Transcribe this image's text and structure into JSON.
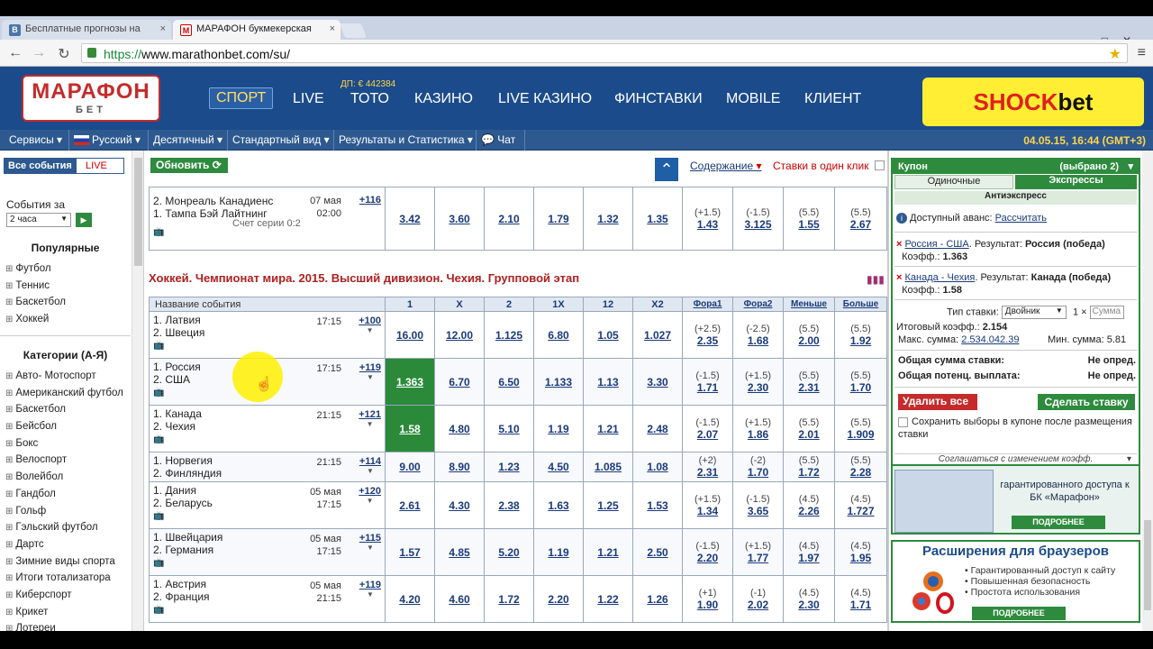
{
  "browser": {
    "tabs": [
      {
        "label": "Бесплатные прогнозы на",
        "favicon": "B"
      },
      {
        "label": "МАРАФОН букмекерская",
        "favicon": "M"
      }
    ],
    "url_prefix": "https://",
    "url": "www.marathonbet.com/su/"
  },
  "header": {
    "logo_top": "МАРАФОН",
    "logo_bottom": "БЕТ",
    "nav": [
      "СПОРТ",
      "LIVE",
      "ТОТО",
      "КАЗИНО",
      "LIVE КАЗИНО",
      "ФИНСТАВКИ",
      "MOBILE",
      "КЛИЕНТ"
    ],
    "toto_jackpot": "ДП: € 442384",
    "ad_red": "SHOCK",
    "ad_black": "bet"
  },
  "menubar": {
    "items": [
      "Сервисы",
      "Русский",
      "Десятичный",
      "Стандартный вид",
      "Результаты и Статистика",
      "Чат"
    ],
    "datetime": "04.05.15, 16:44 (GMT+3)"
  },
  "sidebar": {
    "tab_all": "Все события",
    "tab_live": "LIVE",
    "events_for": "События за",
    "period": "2 часа",
    "popular_title": "Популярные",
    "popular": [
      "Футбол",
      "Теннис",
      "Баскетбол",
      "Хоккей"
    ],
    "categories_title": "Категории (А-Я)",
    "categories": [
      "Авто- Мотоспорт",
      "Американский футбол",
      "Баскетбол",
      "Бейсбол",
      "Бокс",
      "Велоспорт",
      "Волейбол",
      "Гандбол",
      "Гольф",
      "Гэльский футбол",
      "Дартс",
      "Зимние виды спорта",
      "Итоги тотализатора",
      "Киберспорт",
      "Крикет",
      "Лотереи"
    ]
  },
  "center": {
    "refresh": "Обновить",
    "toc": "Содержание",
    "one_click": "Ставки в один клик",
    "prev_match": {
      "team1": "2. Монреаль Канадиенс",
      "team2": "1. Тампа Бэй Лайтнинг",
      "date": "07 мая",
      "time": "02:00",
      "series": "Счет серии 0:2",
      "plus": "+116",
      "odds": [
        "3.42",
        "3.60",
        "2.10",
        "1.79",
        "1.32",
        "1.35"
      ],
      "h1": "(+1.5)",
      "h1v": "1.43",
      "h2": "(-1.5)",
      "h2v": "3.125",
      "u": "(5.5)",
      "uv": "1.55",
      "o": "(5.5)",
      "ov": "2.67"
    },
    "section_title": "Хоккей. Чемпионат мира. 2015. Высший дивизион. Чехия. Групповой этап",
    "columns": [
      "Название события",
      "1",
      "X",
      "2",
      "1X",
      "12",
      "X2",
      "Фора1",
      "Фора2",
      "Меньше",
      "Больше"
    ],
    "matches": [
      {
        "t1": "1. Латвия",
        "t2": "2. Швеция",
        "date": "",
        "time": "17:15",
        "plus": "+100",
        "odds": [
          "16.00",
          "12.00",
          "1.125",
          "6.80",
          "1.05",
          "1.027"
        ],
        "h1": "(+2.5)",
        "h1v": "2.35",
        "h2": "(-2.5)",
        "h2v": "1.68",
        "u": "(5.5)",
        "uv": "2.00",
        "o": "(5.5)",
        "ov": "1.92",
        "tv": true
      },
      {
        "t1": "1. Россия",
        "t2": "2. США",
        "date": "",
        "time": "17:15",
        "plus": "+119",
        "odds": [
          "1.363",
          "6.70",
          "6.50",
          "1.133",
          "1.13",
          "3.30"
        ],
        "h1": "(-1.5)",
        "h1v": "1.71",
        "h2": "(+1.5)",
        "h2v": "2.30",
        "u": "(5.5)",
        "uv": "2.31",
        "o": "(5.5)",
        "ov": "1.70",
        "tv": true,
        "sel": 0
      },
      {
        "t1": "1. Канада",
        "t2": "2. Чехия",
        "date": "",
        "time": "21:15",
        "plus": "+121",
        "odds": [
          "1.58",
          "4.80",
          "5.10",
          "1.19",
          "1.21",
          "2.48"
        ],
        "h1": "(-1.5)",
        "h1v": "2.07",
        "h2": "(+1.5)",
        "h2v": "1.86",
        "u": "(5.5)",
        "uv": "2.01",
        "o": "(5.5)",
        "ov": "1.909",
        "tv": true,
        "sel": 0
      },
      {
        "t1": "1. Норвегия",
        "t2": "2. Финляндия",
        "date": "",
        "time": "21:15",
        "plus": "+114",
        "odds": [
          "9.00",
          "8.90",
          "1.23",
          "4.50",
          "1.085",
          "1.08"
        ],
        "h1": "(+2)",
        "h1v": "2.31",
        "h2": "(-2)",
        "h2v": "1.70",
        "u": "(5.5)",
        "uv": "1.72",
        "o": "(5.5)",
        "ov": "2.28",
        "tv": false
      },
      {
        "t1": "1. Дания",
        "t2": "2. Беларусь",
        "date": "05 мая",
        "time": "17:15",
        "plus": "+120",
        "odds": [
          "2.61",
          "4.30",
          "2.38",
          "1.63",
          "1.25",
          "1.53"
        ],
        "h1": "(+1.5)",
        "h1v": "1.34",
        "h2": "(-1.5)",
        "h2v": "3.65",
        "u": "(4.5)",
        "uv": "2.26",
        "o": "(4.5)",
        "ov": "1.727",
        "tv": true
      },
      {
        "t1": "1. Швейцария",
        "t2": "2. Германия",
        "date": "05 мая",
        "time": "17:15",
        "plus": "+115",
        "odds": [
          "1.57",
          "4.85",
          "5.20",
          "1.19",
          "1.21",
          "2.50"
        ],
        "h1": "(-1.5)",
        "h1v": "2.20",
        "h2": "(+1.5)",
        "h2v": "1.77",
        "u": "(4.5)",
        "uv": "1.97",
        "o": "(4.5)",
        "ov": "1.95",
        "tv": true
      },
      {
        "t1": "1. Австрия",
        "t2": "2. Франция",
        "date": "05 мая",
        "time": "21:15",
        "plus": "+119",
        "odds": [
          "4.20",
          "4.60",
          "1.72",
          "2.20",
          "1.22",
          "1.26"
        ],
        "h1": "(+1)",
        "h1v": "1.90",
        "h2": "(-1)",
        "h2v": "2.02",
        "u": "(4.5)",
        "uv": "2.30",
        "o": "(4.5)",
        "ov": "1.71",
        "tv": true
      }
    ]
  },
  "coupon": {
    "title": "Купон",
    "count": "(выбрано 2)",
    "tab_single": "Одиночные",
    "tab_express": "Экспрессы",
    "anti": "Антиэкспресс",
    "avans": "Доступный аванс:",
    "avans_link": "Рассчитать",
    "bets": [
      {
        "event": "Россия - США",
        "res_label": ". Результат:",
        "res": "Россия (победа)",
        "k_label": "Коэфф.:",
        "k": "1.363"
      },
      {
        "event": "Канада - Чехия",
        "res_label": ". Результат:",
        "res": "Канада (победа)",
        "k_label": "Коэфф.:",
        "k": "1.58"
      }
    ],
    "type_label": "Тип ставки:",
    "type_value": "Двойник",
    "mult": "1 ×",
    "sum_placeholder": "Сумма",
    "total_label": "Итоговый коэфф.:",
    "total": "2.154",
    "max_label": "Макс. сумма:",
    "max": "2.534.042.39",
    "min_label": "Мин. сумма:",
    "min": "5.81",
    "sum_label": "Общая сумма ставки:",
    "sum_val": "Не опред.",
    "payout_label": "Общая потенц. выплата:",
    "payout_val": "Не опред.",
    "delete_all": "Удалить все",
    "place_bet": "Сделать ставку",
    "save_sel": "Сохранить выборы в купоне после размещения ставки",
    "agree": "Соглашаться с изменением коэфф."
  },
  "ads": {
    "ad1_text": "гарантированного доступа к БК «Марафон»",
    "ad1_btn": "ПОДРОБНЕЕ",
    "ad2_title": "Расширения для браузеров",
    "ad2_items": [
      "Гарантированный доступ к сайту",
      "Повышенная безопасность",
      "Простота использования"
    ],
    "ad2_btn": "ПОДРОБНЕЕ"
  },
  "colors": {
    "brand_blue": "#1b4b8a",
    "accent_green": "#2e8b3e",
    "logo_red": "#c52b2b"
  }
}
